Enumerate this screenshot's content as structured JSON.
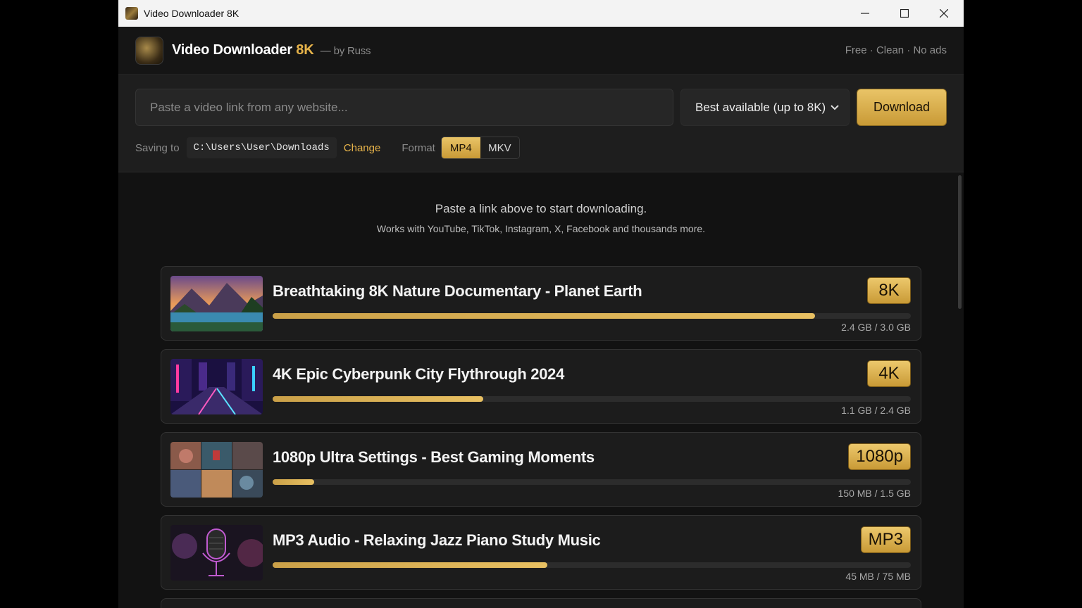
{
  "window": {
    "title": "Video Downloader 8K"
  },
  "header": {
    "brand_main": "Video Downloader",
    "brand_accent": "8K",
    "brand_by": "— by Russ",
    "tagline": "Free · Clean · No ads"
  },
  "controls": {
    "url_placeholder": "Paste a video link from any website...",
    "url_value": "",
    "quality_selected": "Best available (up to 8K)",
    "download_label": "Download",
    "saving_label": "Saving to",
    "save_path": "C:\\Users\\User\\Downloads",
    "change_label": "Change",
    "format_label": "Format",
    "formats": [
      "MP4",
      "MKV"
    ],
    "format_selected": "MP4"
  },
  "empty_state": {
    "line1": "Paste a link above to start downloading.",
    "line2": "Works with YouTube, TikTok, Instagram, X, Facebook and thousands more."
  },
  "downloads": [
    {
      "title": "Breathtaking 8K Nature Documentary - Planet Earth",
      "badge": "8K",
      "progress": 0.85,
      "size": "2.4 GB / 3.0 GB",
      "thumb": "nature"
    },
    {
      "title": "4K Epic Cyberpunk City Flythrough 2024",
      "badge": "4K",
      "progress": 0.33,
      "size": "1.1 GB / 2.4 GB",
      "thumb": "cyberpunk"
    },
    {
      "title": "1080p Ultra Settings - Best Gaming Moments",
      "badge": "1080p",
      "progress": 0.065,
      "size": "150 MB / 1.5 GB",
      "thumb": "gaming"
    },
    {
      "title": "MP3 Audio - Relaxing Jazz Piano Study Music",
      "badge": "MP3",
      "progress": 0.43,
      "size": "45 MB / 75 MB",
      "thumb": "microphone"
    }
  ],
  "colors": {
    "accent": "#e6b34a",
    "background": "#121212",
    "panel": "#1e1e1e"
  }
}
